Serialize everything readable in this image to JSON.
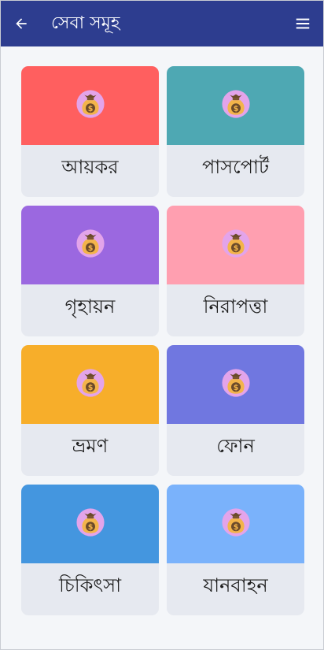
{
  "appbar": {
    "title": "সেবা সমূহ",
    "back_icon": "arrow-left-icon",
    "menu_icon": "hamburger-menu-icon",
    "background": "#2d3d8f"
  },
  "services": [
    {
      "label": "আয়কর",
      "color": "#ff5f5f",
      "icon": "money-bag-icon"
    },
    {
      "label": "পাসপোর্ট",
      "color": "#4ea8b3",
      "icon": "money-bag-icon"
    },
    {
      "label": "গৃহায়ন",
      "color": "#9b68e0",
      "icon": "money-bag-icon"
    },
    {
      "label": "নিরাপত্তা",
      "color": "#ff9fb0",
      "icon": "money-bag-icon"
    },
    {
      "label": "ভ্রমণ",
      "color": "#f7ae2a",
      "icon": "money-bag-icon"
    },
    {
      "label": "ফোন",
      "color": "#7077e0",
      "icon": "money-bag-icon"
    },
    {
      "label": "চিকিৎসা",
      "color": "#4496df",
      "icon": "money-bag-icon"
    },
    {
      "label": "যানবাহন",
      "color": "#7ab2fb",
      "icon": "money-bag-icon"
    }
  ]
}
